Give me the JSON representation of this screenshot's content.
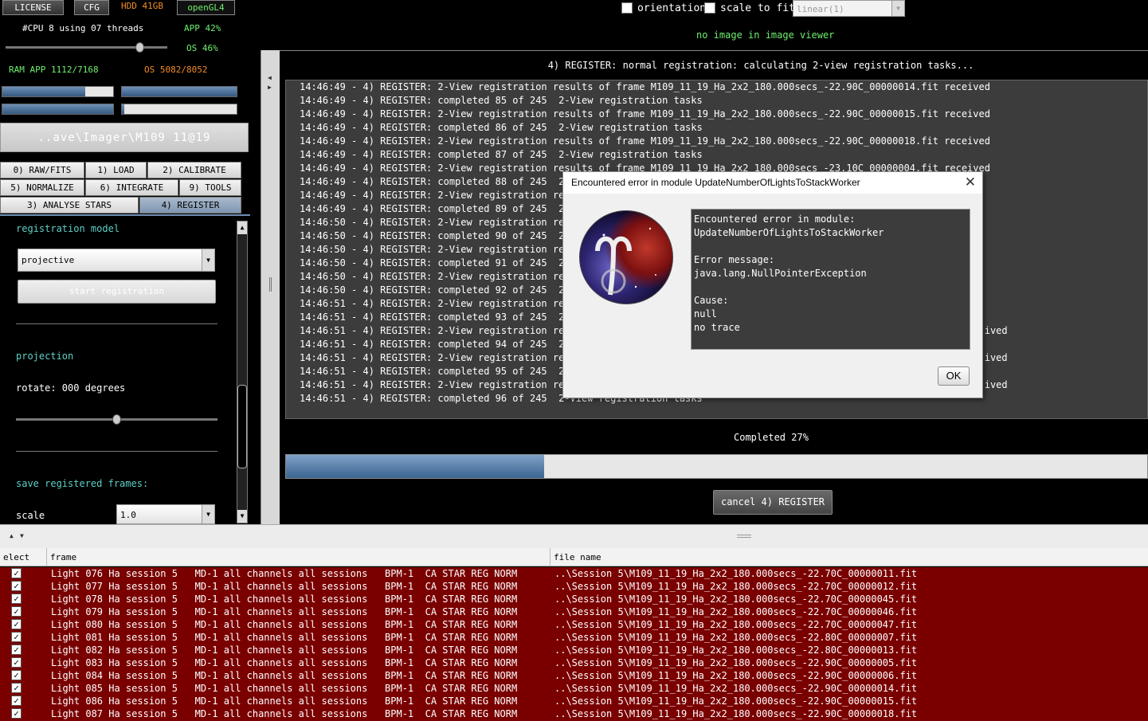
{
  "top": {
    "license": "LICENSE",
    "cfg": "CFG",
    "hdd": "HDD 41GB",
    "opengl": "openGL4",
    "cpu": "#CPU 8  using 07 threads",
    "app_cpu": "APP 42%",
    "os_cpu": "OS 46%",
    "ram": "RAM  APP 1112/7168",
    "os_ram": "OS 5082/8052",
    "path": "..ave\\Imager\\M109 11@19"
  },
  "viewer": {
    "orientation": "orientation",
    "scale_to_fit": "scale to fit",
    "scale_mode": "linear(1)",
    "no_image": "no image in image viewer"
  },
  "tabs": {
    "raw": "0) RAW/FITS",
    "load": "1) LOAD",
    "calibrate": "2) CALIBRATE",
    "normalize": "5) NORMALIZE",
    "integrate": "6) INTEGRATE",
    "tools": "9) TOOLS",
    "analyse": "3) ANALYSE STARS",
    "register": "4) REGISTER"
  },
  "panel": {
    "reg_model_label": "registration model",
    "reg_model_value": "projective",
    "start": "start registration",
    "projection": "projection",
    "rotate": "rotate:  000 degrees",
    "rotate_fraction": 0.5,
    "save_frames": "save registered frames:",
    "scale_label": "scale",
    "scale_value": "1.0"
  },
  "main": {
    "status": "4) REGISTER: normal registration: calculating 2-view registration tasks...",
    "completed": "Completed 27%",
    "progress": 0.3,
    "cancel": "cancel 4) REGISTER"
  },
  "log": [
    "14:46:49 - 4) REGISTER: 2-View registration results of frame M109_11_19_Ha_2x2_180.000secs_-22.90C_00000014.fit received",
    "14:46:49 - 4) REGISTER: completed 85 of 245  2-View registration tasks",
    "14:46:49 - 4) REGISTER: 2-View registration results of frame M109_11_19_Ha_2x2_180.000secs_-22.90C_00000015.fit received",
    "14:46:49 - 4) REGISTER: completed 86 of 245  2-View registration tasks",
    "14:46:49 - 4) REGISTER: 2-View registration results of frame M109_11_19_Ha_2x2_180.000secs_-22.90C_00000018.fit received",
    "14:46:49 - 4) REGISTER: completed 87 of 245  2-View registration tasks",
    "14:46:49 - 4) REGISTER: 2-View registration results of frame M109_11_19_Ha_2x2_180.000secs_-23.10C_00000004.fit received",
    "14:46:49 - 4) REGISTER: completed 88 of 245  2-",
    "14:46:49 - 4) REGISTER: 2-View registration res",
    "14:46:49 - 4) REGISTER: completed 89 of 245  2-",
    "14:46:50 - 4) REGISTER: 2-View registration res",
    "14:46:50 - 4) REGISTER: completed 90 of 245  2-",
    "14:46:50 - 4) REGISTER: 2-View registration res",
    "14:46:50 - 4) REGISTER: completed 91 of 245  2-",
    "14:46:50 - 4) REGISTER: 2-View registration res",
    "14:46:50 - 4) REGISTER: completed 92 of 245  2-",
    "14:46:51 - 4) REGISTER: 2-View registration res",
    "14:46:51 - 4) REGISTER: completed 93 of 245  2-",
    "14:46:51 - 4) REGISTER: 2-View registration res                                                                        ived",
    "14:46:51 - 4) REGISTER: completed 94 of 245  2-",
    "14:46:51 - 4) REGISTER: 2-View registration res                                                                        ived",
    "14:46:51 - 4) REGISTER: completed 95 of 245  2-",
    "14:46:51 - 4) REGISTER: 2-View registration res                                                                        ived",
    "14:46:51 - 4) REGISTER: completed 96 of 245  2-View registration tasks"
  ],
  "table": {
    "col_select": "elect",
    "col_frame": "frame",
    "col_file": "file name",
    "rows": [
      {
        "frame": "Light 076 Ha session 5   MD-1 all channels all sessions   BPM-1  CA STAR REG NORM",
        "file": "..\\Session 5\\M109_11_19_Ha_2x2_180.000secs_-22.70C_00000011.fit"
      },
      {
        "frame": "Light 077 Ha session 5   MD-1 all channels all sessions   BPM-1  CA STAR REG NORM",
        "file": "..\\Session 5\\M109_11_19_Ha_2x2_180.000secs_-22.70C_00000012.fit"
      },
      {
        "frame": "Light 078 Ha session 5   MD-1 all channels all sessions   BPM-1  CA STAR REG NORM",
        "file": "..\\Session 5\\M109_11_19_Ha_2x2_180.000secs_-22.70C_00000045.fit"
      },
      {
        "frame": "Light 079 Ha session 5   MD-1 all channels all sessions   BPM-1  CA STAR REG NORM",
        "file": "..\\Session 5\\M109_11_19_Ha_2x2_180.000secs_-22.70C_00000046.fit"
      },
      {
        "frame": "Light 080 Ha session 5   MD-1 all channels all sessions   BPM-1  CA STAR REG NORM",
        "file": "..\\Session 5\\M109_11_19_Ha_2x2_180.000secs_-22.70C_00000047.fit"
      },
      {
        "frame": "Light 081 Ha session 5   MD-1 all channels all sessions   BPM-1  CA STAR REG NORM",
        "file": "..\\Session 5\\M109_11_19_Ha_2x2_180.000secs_-22.80C_00000007.fit"
      },
      {
        "frame": "Light 082 Ha session 5   MD-1 all channels all sessions   BPM-1  CA STAR REG NORM",
        "file": "..\\Session 5\\M109_11_19_Ha_2x2_180.000secs_-22.80C_00000013.fit"
      },
      {
        "frame": "Light 083 Ha session 5   MD-1 all channels all sessions   BPM-1  CA STAR REG NORM",
        "file": "..\\Session 5\\M109_11_19_Ha_2x2_180.000secs_-22.90C_00000005.fit"
      },
      {
        "frame": "Light 084 Ha session 5   MD-1 all channels all sessions   BPM-1  CA STAR REG NORM",
        "file": "..\\Session 5\\M109_11_19_Ha_2x2_180.000secs_-22.90C_00000006.fit"
      },
      {
        "frame": "Light 085 Ha session 5   MD-1 all channels all sessions   BPM-1  CA STAR REG NORM",
        "file": "..\\Session 5\\M109_11_19_Ha_2x2_180.000secs_-22.90C_00000014.fit"
      },
      {
        "frame": "Light 086 Ha session 5   MD-1 all channels all sessions   BPM-1  CA STAR REG NORM",
        "file": "..\\Session 5\\M109_11_19_Ha_2x2_180.000secs_-22.90C_00000015.fit"
      },
      {
        "frame": "Light 087 Ha session 5   MD-1 all channels all sessions   BPM-1  CA STAR REG NORM",
        "file": "..\\Session 5\\M109_11_19_Ha_2x2_180.000secs_-22.90C_00000018.fit"
      }
    ]
  },
  "dialog": {
    "title": "Encountered error in module UpdateNumberOfLightsToStackWorker",
    "message": "Encountered error in module:\nUpdateNumberOfLightsToStackWorker\n\nError message:\njava.lang.NullPointerException\n\nCause:\nnull\nno trace",
    "ok": "OK",
    "close": "✕"
  },
  "colors": {
    "row_bg": "#7a0000",
    "green": "#6df06d",
    "orange": "#f28c2a",
    "cyan": "#5ed0c8"
  }
}
